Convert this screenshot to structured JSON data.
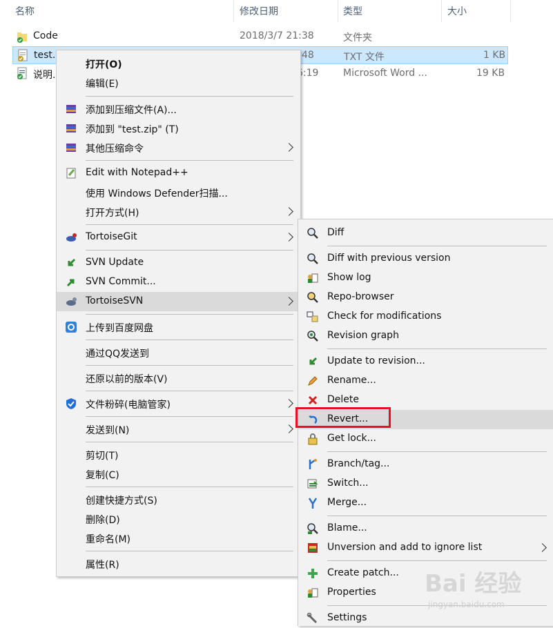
{
  "columns": {
    "name": "名称",
    "date": "修改日期",
    "type": "类型",
    "size": "大小"
  },
  "files": [
    {
      "name": "Code",
      "date": "2018/3/7 21:38",
      "type": "文件夹",
      "size": ""
    },
    {
      "name": "test.",
      "date": "48",
      "type": "TXT 文件",
      "size": "1 KB"
    },
    {
      "name": "说明.",
      "date": "6:19",
      "type": "Microsoft Word ...",
      "size": "19 KB"
    }
  ],
  "context_menu": {
    "open": "打开(O)",
    "edit": "编辑(E)",
    "add_archive": "添加到压缩文件(A)...",
    "add_zip": "添加到 \"test.zip\" (T)",
    "other_compress": "其他压缩命令",
    "notepad": "Edit with Notepad++",
    "defender": "使用 Windows Defender扫描...",
    "open_with": "打开方式(H)",
    "tortoisegit": "TortoiseGit",
    "svn_update": "SVN Update",
    "svn_commit": "SVN Commit...",
    "tortoisesvn": "TortoiseSVN",
    "baidu": "上传到百度网盘",
    "qq": "通过QQ发送到",
    "restore": "还原以前的版本(V)",
    "shred": "文件粉碎(电脑管家)",
    "send_to": "发送到(N)",
    "cut": "剪切(T)",
    "copy": "复制(C)",
    "shortcut": "创建快捷方式(S)",
    "delete": "删除(D)",
    "rename": "重命名(M)",
    "properties": "属性(R)"
  },
  "svn_menu": {
    "diff": "Diff",
    "diff_prev": "Diff with previous version",
    "show_log": "Show log",
    "repo_browser": "Repo-browser",
    "check_mod": "Check for modifications",
    "revision_graph": "Revision graph",
    "update_rev": "Update to revision...",
    "rename": "Rename...",
    "delete": "Delete",
    "revert": "Revert...",
    "get_lock": "Get lock...",
    "branch_tag": "Branch/tag...",
    "switch": "Switch...",
    "merge": "Merge...",
    "blame": "Blame...",
    "unversion": "Unversion and add to ignore list",
    "create_patch": "Create patch...",
    "properties": "Properties",
    "settings": "Settings"
  },
  "watermark": {
    "logo": "Bai 经验",
    "url": "jingyan.baidu.com"
  },
  "colors": {
    "selection": "#cce8ff",
    "highlight": "#dadada",
    "red_box": "#e81123"
  }
}
